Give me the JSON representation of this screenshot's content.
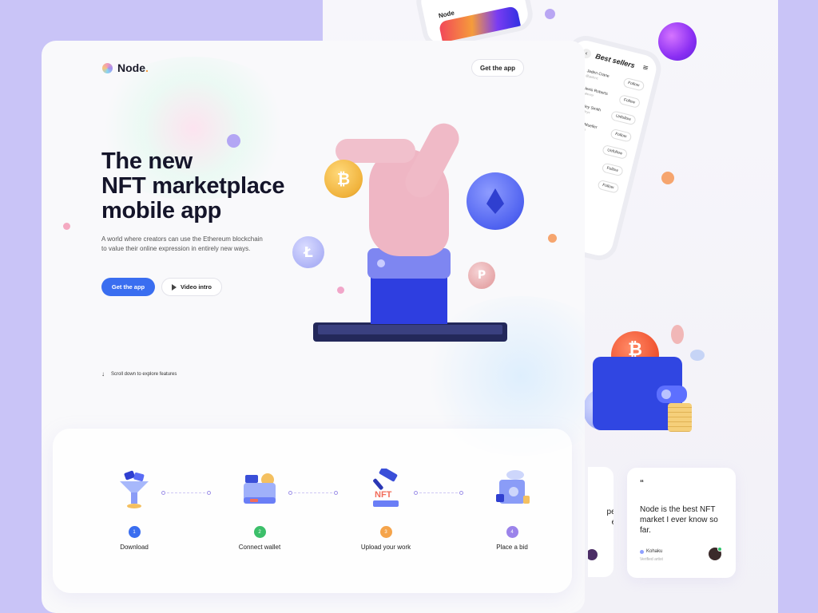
{
  "brand": {
    "name": "Node",
    "dot": "."
  },
  "header": {
    "get_app_label": "Get the app"
  },
  "hero": {
    "title_line1": "The new",
    "title_line2": "NFT marketplace",
    "title_line3": "mobile app",
    "description": "A world where creators can use the Ethereum blockchain to value their online expression in entirely new ways.",
    "primary_cta": "Get the app",
    "secondary_cta": "Video intro",
    "scroll_hint": "Scroll down to explore features"
  },
  "coins": {
    "btc": "₿",
    "ltc": "Ł",
    "dot": "P"
  },
  "steps": [
    {
      "number": "1",
      "label": "Download",
      "color": "#3a6ef0"
    },
    {
      "number": "2",
      "label": "Connect wallet",
      "color": "#3cbf6a"
    },
    {
      "number": "3",
      "label": "Upload your work",
      "color": "#f5a44b"
    },
    {
      "number": "4",
      "label": "Place a bid",
      "color": "#9b83ea"
    }
  ],
  "step_illustrations": {
    "nft_tag": "NFT"
  },
  "phone_top": {
    "title": "Node"
  },
  "best_sellers": {
    "title": "Best sellers",
    "sellers": [
      {
        "name": "Jaden Crane",
        "handle": "@jadenc",
        "action": "Follow"
      },
      {
        "name": "Alexis Roberts",
        "handle": "@alexisr",
        "action": "Follow"
      },
      {
        "name": "Lesley Smith",
        "handle": "@lesleys",
        "action": "Unfollow"
      },
      {
        "name": "Brian Mueller",
        "handle": "@brianm",
        "action": "Follow"
      },
      {
        "name": "",
        "handle": "",
        "action": "Unfollow"
      },
      {
        "name": "",
        "handle": "",
        "action": "Follow"
      },
      {
        "name": "",
        "handle": "",
        "action": "Follow"
      }
    ]
  },
  "wallet_coin": "₿",
  "testimonials": {
    "partial_text": "per\net",
    "main": {
      "quote_mark": "“",
      "text": "Node is the best NFT market I ever know so far.",
      "author": "Kohaku",
      "role": "Verified artist"
    }
  },
  "colors": {
    "accent": "#3a6ef0",
    "background": "#c9c4f7",
    "brand_dot": "#f59a3b"
  }
}
